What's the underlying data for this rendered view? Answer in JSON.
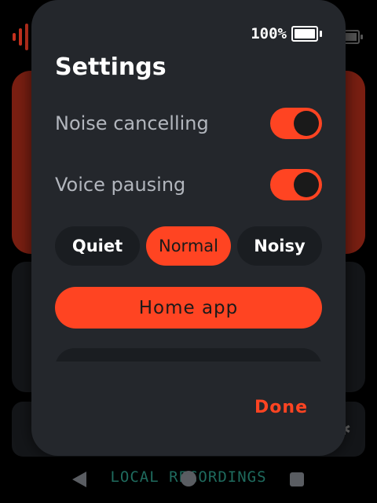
{
  "status": {
    "battery_text": "100%",
    "battery_level": 1.0
  },
  "settings": {
    "title": "Settings",
    "noise_cancelling": {
      "label": "Noise cancelling",
      "on": true
    },
    "voice_pausing": {
      "label": "Voice pausing",
      "on": true
    },
    "environment": {
      "options": [
        "Quiet",
        "Normal",
        "Noisy"
      ],
      "selected": "Normal"
    },
    "home_app_label": "Home app",
    "done_label": "Done"
  },
  "nav": {
    "label": "LOCAL RECORDINGS"
  },
  "colors": {
    "accent": "#ff4422",
    "modal_bg": "#24272c",
    "chip_bg": "#1a1d21"
  }
}
